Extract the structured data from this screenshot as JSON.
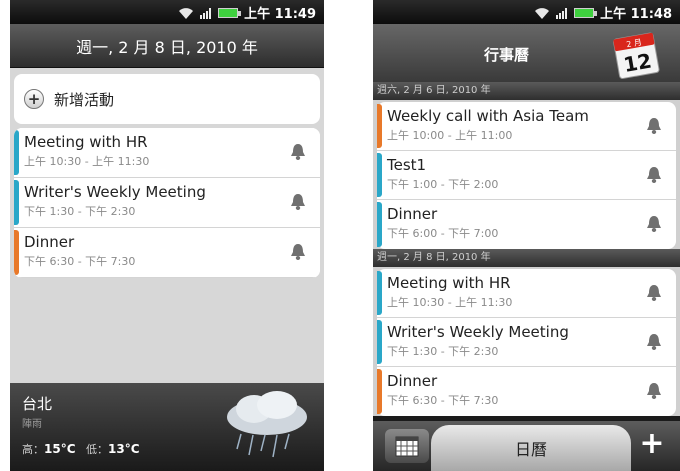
{
  "left": {
    "status": {
      "time": "上午 11:49"
    },
    "date_header": "週一, 2 月 8 日, 2010 年",
    "add_event_label": "新增活動",
    "events": [
      {
        "title": "Meeting with HR",
        "time": "上午 10:30 - 上午 11:30",
        "color": "#2aa7c8"
      },
      {
        "title": "Writer's Weekly Meeting",
        "time": "下午 1:30 - 下午 2:30",
        "color": "#2aa7c8"
      },
      {
        "title": "Dinner",
        "time": "下午 6:30 - 下午 7:30",
        "color": "#e8792a"
      }
    ],
    "weather": {
      "city": "台北",
      "condition": "陣雨",
      "high_label": "高：",
      "high": "15°C",
      "low_label": "低：",
      "low": "13°C"
    }
  },
  "right": {
    "status": {
      "time": "上午 11:48"
    },
    "title": "行事曆",
    "calendar_icon": {
      "month": "2 月",
      "day": "12"
    },
    "days": [
      {
        "header": "週六, 2 月 6 日, 2010 年",
        "events": [
          {
            "title": "Weekly call with Asia Team",
            "time": "上午 10:00 - 上午 11:00",
            "color": "#e8792a"
          },
          {
            "title": "Test1",
            "time": "下午 1:00 - 下午 2:00",
            "color": "#2aa7c8"
          },
          {
            "title": "Dinner",
            "time": "下午 6:00 - 下午 7:00",
            "color": "#2aa7c8"
          }
        ]
      },
      {
        "header": "週一, 2 月 8 日, 2010 年",
        "events": [
          {
            "title": "Meeting with HR",
            "time": "上午 10:30 - 上午 11:30",
            "color": "#2aa7c8"
          },
          {
            "title": "Writer's Weekly Meeting",
            "time": "下午 1:30 - 下午 2:30",
            "color": "#2aa7c8"
          },
          {
            "title": "Dinner",
            "time": "下午 6:30 - 下午 7:30",
            "color": "#e8792a"
          }
        ]
      }
    ],
    "bottom": {
      "tab_label": "日曆",
      "add_label": "+"
    }
  },
  "icons": {
    "status": [
      "wifi-icon",
      "signal-icon",
      "battery-icon"
    ],
    "event": "bell-icon",
    "weather": "cloud-rain-icon",
    "grid": "grid-icon",
    "calendar": "calendar-icon"
  }
}
